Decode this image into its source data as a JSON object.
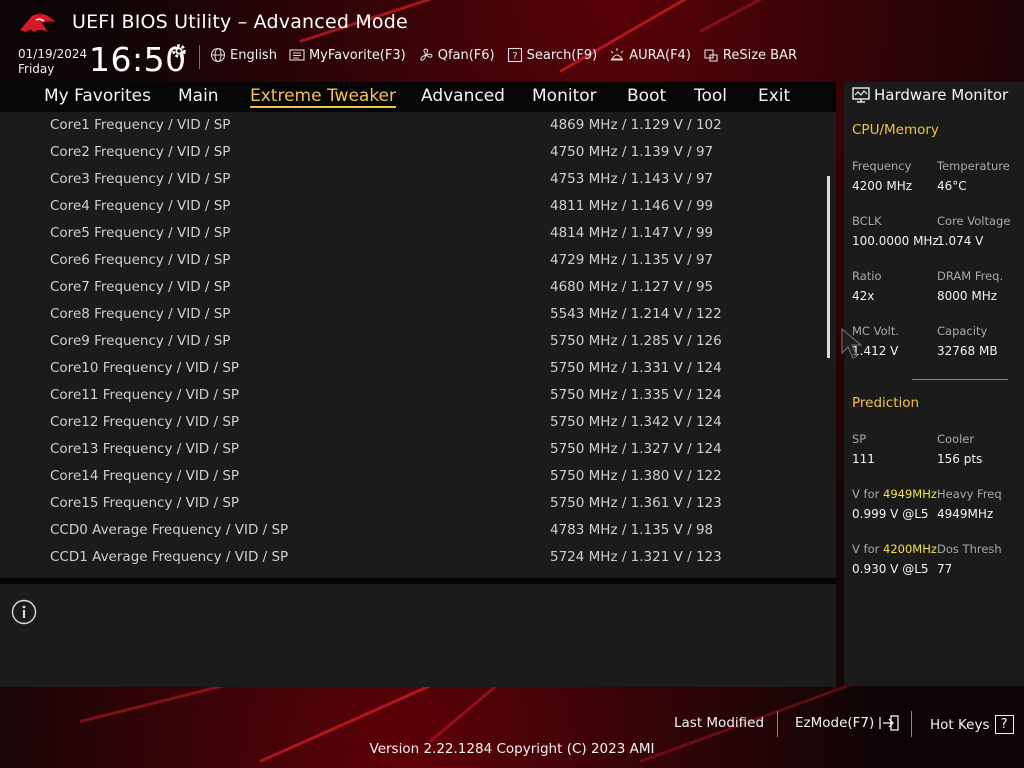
{
  "header": {
    "title": "UEFI BIOS Utility – Advanced Mode",
    "date": "01/19/2024",
    "day": "Friday",
    "time": "16:50",
    "toolbar": [
      {
        "label": "English",
        "icon": "globe-icon"
      },
      {
        "label": "MyFavorite(F3)",
        "icon": "favorite-list-icon"
      },
      {
        "label": "Qfan(F6)",
        "icon": "fan-icon"
      },
      {
        "label": "Search(F9)",
        "icon": "search-help-icon"
      },
      {
        "label": "AURA(F4)",
        "icon": "aura-light-icon"
      },
      {
        "label": "ReSize BAR",
        "icon": "resize-bar-icon"
      }
    ]
  },
  "nav": {
    "tabs": [
      "My Favorites",
      "Main",
      "Extreme Tweaker",
      "Advanced",
      "Monitor",
      "Boot",
      "Tool",
      "Exit"
    ],
    "active": "Extreme Tweaker"
  },
  "main": {
    "rows": [
      {
        "label": "Core1 Frequency / VID / SP",
        "value": "4869 MHz / 1.129 V / 102"
      },
      {
        "label": "Core2 Frequency / VID / SP",
        "value": "4750 MHz / 1.139 V / 97"
      },
      {
        "label": "Core3 Frequency / VID / SP",
        "value": "4753 MHz / 1.143 V / 97"
      },
      {
        "label": "Core4 Frequency / VID / SP",
        "value": "4811 MHz / 1.146 V / 99"
      },
      {
        "label": "Core5 Frequency / VID / SP",
        "value": "4814 MHz / 1.147 V / 99"
      },
      {
        "label": "Core6 Frequency / VID / SP",
        "value": "4729 MHz / 1.135 V / 97"
      },
      {
        "label": "Core7 Frequency / VID / SP",
        "value": "4680 MHz / 1.127 V / 95"
      },
      {
        "label": "Core8 Frequency / VID / SP",
        "value": "5543 MHz / 1.214 V / 122"
      },
      {
        "label": "Core9 Frequency / VID / SP",
        "value": "5750 MHz / 1.285 V / 126"
      },
      {
        "label": "Core10 Frequency / VID / SP",
        "value": "5750 MHz / 1.331 V / 124"
      },
      {
        "label": "Core11 Frequency / VID / SP",
        "value": "5750 MHz / 1.335 V / 124"
      },
      {
        "label": "Core12 Frequency / VID / SP",
        "value": "5750 MHz / 1.342 V / 124"
      },
      {
        "label": "Core13 Frequency / VID / SP",
        "value": "5750 MHz / 1.327 V / 124"
      },
      {
        "label": "Core14 Frequency / VID / SP",
        "value": "5750 MHz / 1.380 V / 122"
      },
      {
        "label": "Core15 Frequency / VID / SP",
        "value": "5750 MHz / 1.361 V / 123"
      },
      {
        "label": "CCD0 Average Frequency / VID / SP",
        "value": "4783 MHz / 1.135 V / 98"
      },
      {
        "label": "CCD1 Average Frequency / VID / SP",
        "value": "5724 MHz / 1.321 V / 123"
      }
    ]
  },
  "hw_monitor": {
    "title": "Hardware Monitor",
    "cpu_memory": {
      "heading": "CPU/Memory",
      "items": [
        {
          "label": "Frequency",
          "value": "4200 MHz"
        },
        {
          "label": "Temperature",
          "value": "46°C"
        },
        {
          "label": "BCLK",
          "value": "100.0000 MHz"
        },
        {
          "label": "Core Voltage",
          "value": "1.074 V"
        },
        {
          "label": "Ratio",
          "value": "42x"
        },
        {
          "label": "DRAM Freq.",
          "value": "8000 MHz"
        },
        {
          "label": "MC Volt.",
          "value": "1.412 V"
        },
        {
          "label": "Capacity",
          "value": "32768 MB"
        }
      ]
    },
    "prediction": {
      "heading": "Prediction",
      "sp_label": "SP",
      "sp_value": "111",
      "cooler_label": "Cooler",
      "cooler_value": "156 pts",
      "vfor1_prefix": "V for ",
      "vfor1_freq": "4949MHz",
      "vfor1_value": "0.999 V @L5",
      "heavy_label": "Heavy Freq",
      "heavy_value": "4949MHz",
      "vfor2_prefix": "V for ",
      "vfor2_freq": "4200MHz",
      "vfor2_value": "0.930 V @L5",
      "dos_label": "Dos Thresh",
      "dos_value": "77"
    }
  },
  "footer": {
    "last_modified": "Last Modified",
    "ezmode": "EzMode(F7)",
    "hotkeys": "Hot Keys",
    "hotkeys_key": "?",
    "version": "Version 2.22.1284 Copyright (C) 2023 AMI"
  },
  "colors": {
    "accent": "#f2c14e",
    "highlight": "#f2e14a",
    "panel": "#1b1b1b",
    "brand_red": "#c8101e"
  }
}
